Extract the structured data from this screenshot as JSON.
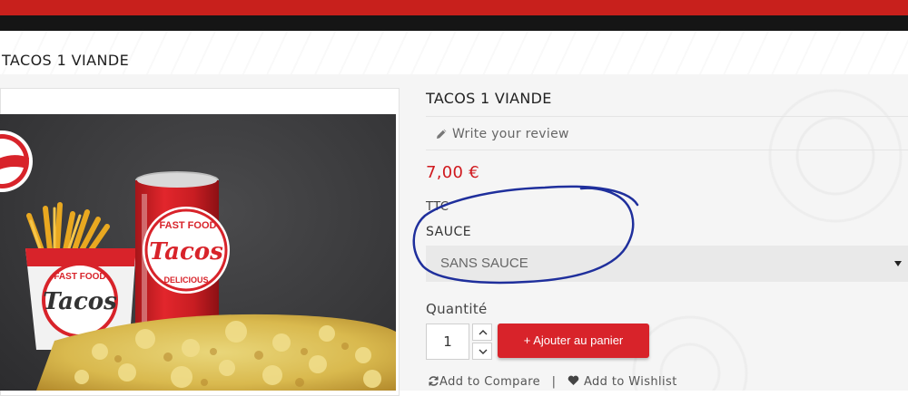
{
  "page": {
    "title": "TACOS 1 VIANDE"
  },
  "product": {
    "name": "TACOS 1 VIANDE",
    "review_link": "Write your review",
    "price": "7,00 €",
    "tax_label": "TTC",
    "sauce_label": "SAUCE",
    "sauce_selected": "SANS SAUCE",
    "quantity_label": "Quantité",
    "quantity_value": "1",
    "add_to_cart": "+ Ajouter au panier",
    "compare_link": "Add to Compare",
    "separator": "|",
    "wishlist_link": "Add to Wishlist"
  },
  "image_texts": {
    "can_top": "FAST FOOD",
    "can_brand": "Tacos",
    "can_bottom": "DELICIOUS",
    "box_top": "FAST FOOD",
    "box_brand": "Tacos"
  },
  "colors": {
    "brand_red": "#d8232a",
    "price_red": "#d0191e",
    "annotation_blue": "#1f2f9c"
  }
}
